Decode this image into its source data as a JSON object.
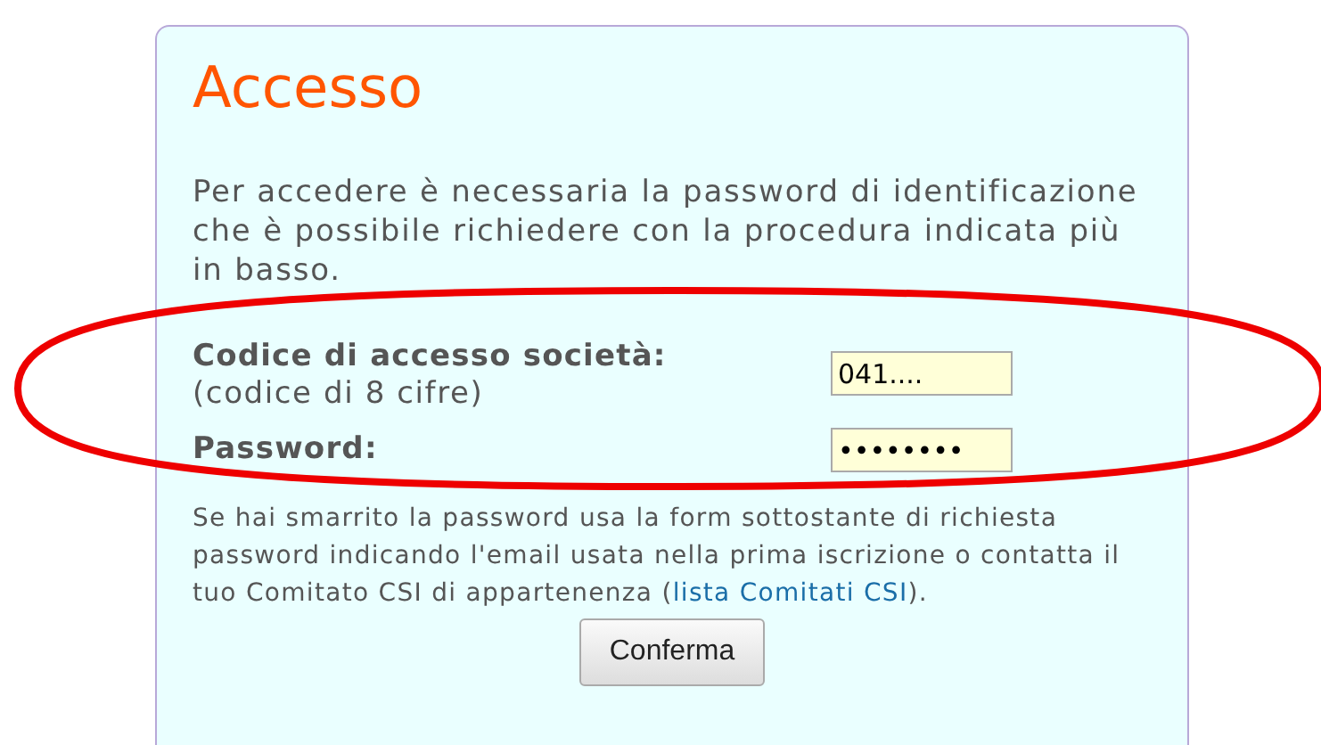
{
  "panel": {
    "title": "Accesso",
    "intro": "Per accedere è necessaria la password di identificazione che è possibile richiedere con la procedura indicata più in basso.",
    "fields": [
      {
        "label": "Codice di accesso società:",
        "hint": "(codice di 8 cifre)",
        "value": "041...."
      },
      {
        "label": "Password:",
        "value": "••••••••"
      }
    ],
    "help": {
      "before": "Se hai smarrito la password usa la form sottostante di richiesta password indicando l'email usata nella prima iscrizione o contatta il tuo Comitato CSI di appartenenza (",
      "link": "lista Comitati CSI",
      "after": ")."
    },
    "button": "Conferma"
  }
}
